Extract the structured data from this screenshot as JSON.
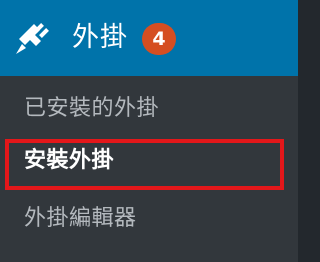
{
  "header": {
    "icon": "plugin-icon",
    "label": "外掛",
    "badge_count": "4"
  },
  "submenu": {
    "items": [
      {
        "label": "已安裝的外掛",
        "current": false
      },
      {
        "label": "安裝外掛",
        "current": true
      },
      {
        "label": "外掛編輯器",
        "current": false
      }
    ]
  },
  "colors": {
    "header_bg": "#0073aa",
    "menu_bg": "#32373c",
    "badge_bg": "#d54e21",
    "highlight_border": "#e3171a",
    "text_inactive": "#b4b9be",
    "text_active": "#ffffff"
  }
}
